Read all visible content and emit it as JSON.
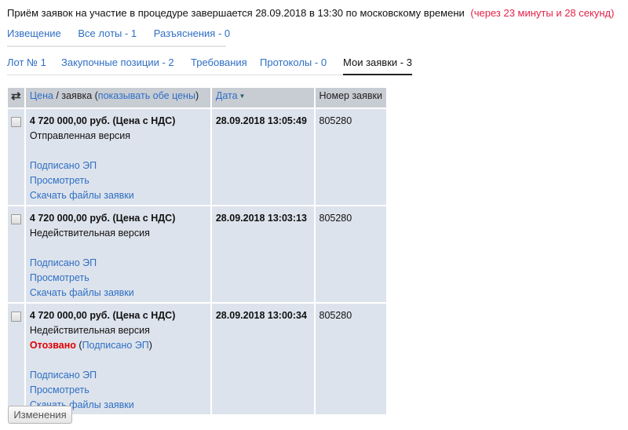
{
  "notice": {
    "text": "Приём заявок на участие в процедуре завершается 28.09.2018 в 13:30 по московскому времени",
    "countdown": "(через 23 минуты и 28 секунд)",
    "countdown_color": "#e3234a"
  },
  "top_nav": [
    {
      "label": "Извещение"
    },
    {
      "label": "Все лоты - 1"
    },
    {
      "label": "Разъяснения - 0"
    }
  ],
  "lot_tabs": [
    {
      "label": "Лот № 1",
      "active": false
    },
    {
      "label": "Закупочные позиции - 2",
      "active": false
    },
    {
      "label": "Требования",
      "active": false
    },
    {
      "label": "Протоколы - 0",
      "active": false
    },
    {
      "label": "Мои заявки - 3",
      "active": true
    }
  ],
  "table": {
    "header": {
      "swap_icon": "swap-arrows-icon",
      "price_link": "Цена",
      "price_sep": " / заявка (",
      "show_both_link": "показывать обе цены",
      "price_close": ")",
      "date_label": "Дата",
      "sort_icon": "sort-desc-icon",
      "number_label": "Номер заявки"
    },
    "rows": [
      {
        "price": "4 720 000,00 руб. (Цена с НДС)",
        "version": "Отправленная версия",
        "status": null,
        "links": [
          "Подписано ЭП",
          "Просмотреть",
          "Скачать файлы заявки"
        ],
        "date": "28.09.2018 13:05:49",
        "number": "805280"
      },
      {
        "price": "4 720 000,00 руб. (Цена с НДС)",
        "version": "Недействительная версия",
        "status": null,
        "links": [
          "Подписано ЭП",
          "Просмотреть",
          "Скачать файлы заявки"
        ],
        "date": "28.09.2018 13:03:13",
        "number": "805280"
      },
      {
        "price": "4 720 000,00 руб. (Цена с НДС)",
        "version": "Недействительная версия",
        "status": {
          "label": "Отозвано",
          "open": " (",
          "link": "Подписано ЭП",
          "close": ")"
        },
        "links": [
          "Подписано ЭП",
          "Просмотреть",
          "Скачать файлы заявки"
        ],
        "date": "28.09.2018 13:00:34",
        "number": "805280"
      }
    ]
  },
  "changes_button": "Изменения"
}
